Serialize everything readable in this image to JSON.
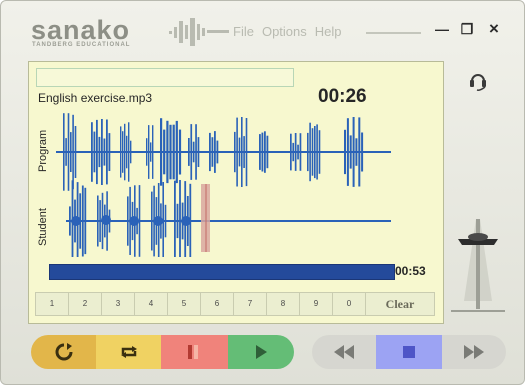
{
  "app": {
    "logo": "sanako",
    "logo_sub": "TANDBERG EDUCATIONAL"
  },
  "menu": [
    "File",
    "Options",
    "Help"
  ],
  "window_controls": {
    "minimize": "—",
    "restore": "❐",
    "close": "×"
  },
  "player": {
    "filename": "English exercise.mp3",
    "elapsed": "00:26",
    "total": "00:53",
    "progress": 0.99,
    "tracks": {
      "program_label": "Program",
      "student_label": "Student"
    }
  },
  "bookmarks": [
    "1",
    "2",
    "3",
    "4",
    "5",
    "6",
    "7",
    "8",
    "9",
    "0"
  ],
  "clear_label": "Clear",
  "volume_level": 0.75,
  "icons": {
    "headset": "headset-icon",
    "repeat": "repeat-icon",
    "loop": "loop-icon",
    "record": "record-icon",
    "play": "play-icon",
    "rewind": "rewind-icon",
    "stop": "stop-icon",
    "fast_forward": "fast-forward-icon"
  },
  "colors": {
    "panel": "#f7f8cf",
    "waveform": "#2a62b8",
    "progress": "#244a9b",
    "btn_repeat": "#e2b64a",
    "btn_loop": "#f0d262",
    "btn_record": "#f0837b",
    "btn_play": "#64bd76",
    "btn_nav": "#d6d6d0",
    "btn_stop": "#9ca3f3"
  }
}
